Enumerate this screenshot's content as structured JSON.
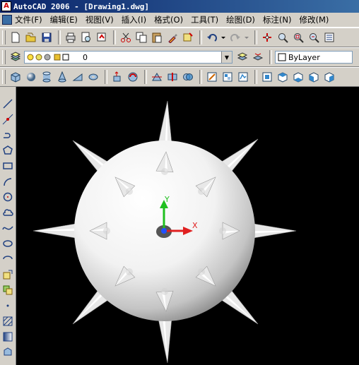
{
  "window": {
    "title": "AutoCAD 2006 - [Drawing1.dwg]"
  },
  "menu": {
    "items": [
      "文件(F)",
      "编辑(E)",
      "视图(V)",
      "插入(I)",
      "格式(O)",
      "工具(T)",
      "绘图(D)",
      "标注(N)",
      "修改(M)"
    ]
  },
  "layers": {
    "current_layer": "0",
    "linetype": "ByLayer"
  },
  "ucs": {
    "x_label": "X",
    "y_label": "Y"
  },
  "icons": {
    "standard_toolbar": [
      "new-icon",
      "open-icon",
      "save-icon",
      "plot-icon",
      "plot-preview-icon",
      "publish-icon",
      "cut-icon",
      "copy-icon",
      "paste-icon",
      "match-properties-icon",
      "block-editor-icon",
      "undo-icon",
      "redo-icon",
      "pan-icon",
      "zoom-realtime-icon",
      "zoom-window-icon",
      "zoom-previous-icon",
      "properties-icon"
    ],
    "solids_toolbar": [
      "box-icon",
      "sphere-icon",
      "cylinder-icon",
      "cone-icon",
      "wedge-icon",
      "torus-icon",
      "extrude-icon",
      "revolve-icon",
      "slice-icon",
      "section-icon",
      "interference-icon",
      "setup-drawing-icon",
      "setup-view-icon",
      "setup-profile-icon"
    ],
    "view_toolbar": [
      "named-views-icon",
      "top-view-icon",
      "bottom-view-icon",
      "left-view-icon",
      "right-view-icon"
    ],
    "draw_toolbar": [
      "line-icon",
      "construction-line-icon",
      "polyline-icon",
      "polygon-icon",
      "rectangle-icon",
      "arc-icon",
      "circle-icon",
      "revision-cloud-icon",
      "spline-icon",
      "ellipse-icon",
      "ellipse-arc-icon",
      "insert-block-icon",
      "make-block-icon",
      "point-icon",
      "hatch-icon",
      "gradient-icon",
      "region-icon"
    ]
  },
  "colors": {
    "titlebar": "#0a246a",
    "viewport": "#000000",
    "ucs_x": "#e02020",
    "ucs_y": "#20c020",
    "ucs_origin": "#2050ff"
  }
}
